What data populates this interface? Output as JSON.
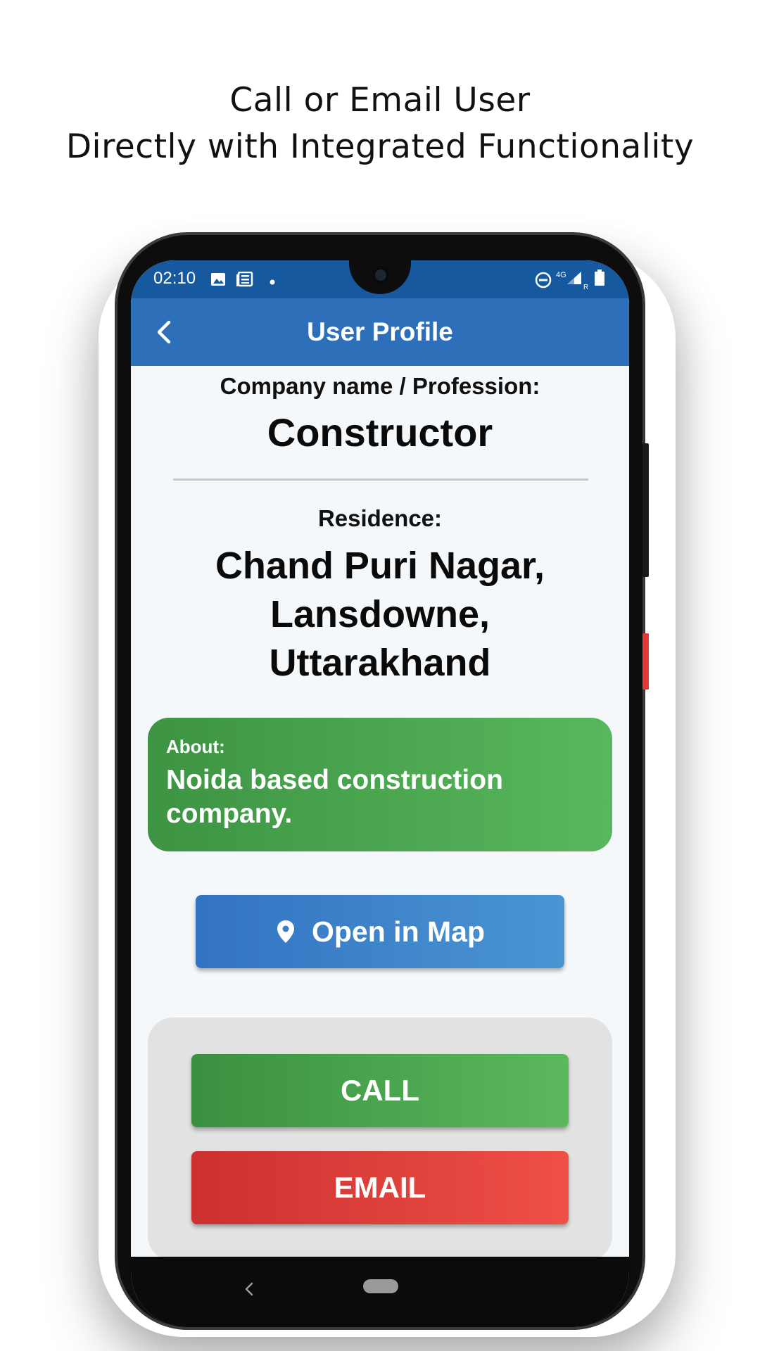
{
  "caption": {
    "line1": "Call or Email User",
    "line2": "Directly with Integrated Functionality"
  },
  "status_bar": {
    "time": "02:10",
    "left_icons": [
      "image-icon",
      "news-icon",
      "dot-icon"
    ],
    "right_icons": [
      "do-not-disturb-icon",
      "signal-4g-icon",
      "signal-bars-icon",
      "battery-icon"
    ],
    "network_label": "4G",
    "roaming_label": "R"
  },
  "app_bar": {
    "title": "User Profile",
    "back_icon": "chevron-left-icon",
    "color": "#2e6fb9"
  },
  "profile": {
    "company_label": "Company name / Profession:",
    "company_value": "Constructor",
    "residence_label": "Residence:",
    "residence_lines": [
      "Chand Puri Nagar,",
      "Lansdowne,",
      "Uttarakhand"
    ],
    "about_label": "About:",
    "about_lines": [
      "Noida based construction",
      "company."
    ]
  },
  "buttons": {
    "open_map": "Open in Map",
    "call": "CALL",
    "email": "EMAIL"
  },
  "colors": {
    "about_card": "#4caf50",
    "map_button": "#3a84c9",
    "call_button": "#4caf50",
    "email_button": "#e53935"
  }
}
